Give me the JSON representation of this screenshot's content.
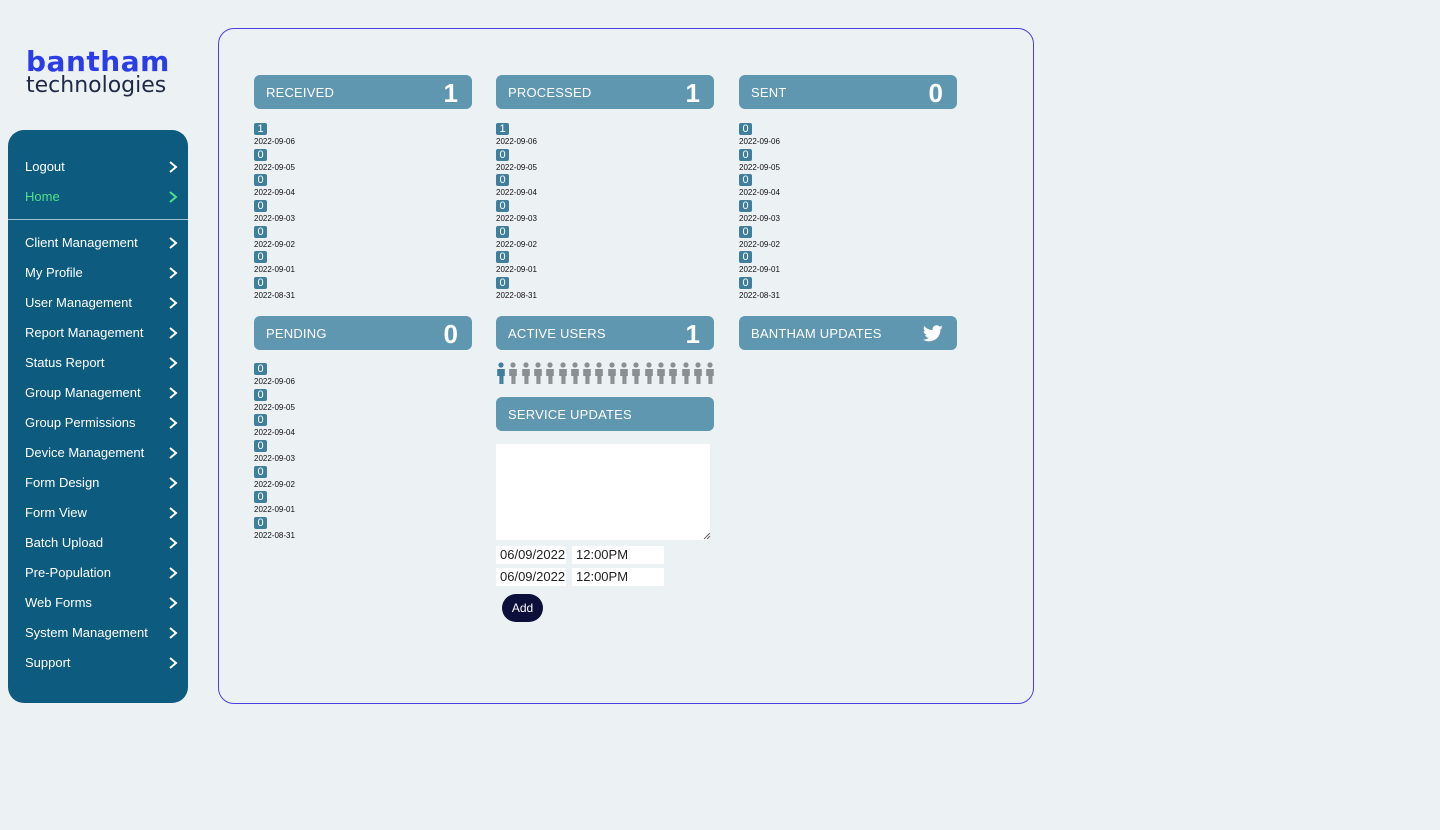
{
  "logo": {
    "line1": "bantham",
    "line2": "technologies"
  },
  "nav": {
    "top": [
      {
        "label": "Logout",
        "active": false
      },
      {
        "label": "Home",
        "active": true
      }
    ],
    "items": [
      "Client Management",
      "My Profile",
      "User  Management",
      "Report Management",
      "Status Report",
      "Group Management",
      "Group Permissions",
      "Device Management",
      "Form Design",
      "Form View",
      "Batch Upload",
      "Pre-Population",
      "Web Forms",
      "System Management",
      "Support"
    ]
  },
  "cards": {
    "received": {
      "title": "RECEIVED",
      "count": "1"
    },
    "processed": {
      "title": "PROCESSED",
      "count": "1"
    },
    "sent": {
      "title": "SENT",
      "count": "0"
    },
    "pending": {
      "title": "PENDING",
      "count": "0"
    },
    "active_users": {
      "title": "ACTIVE USERS",
      "count": "1"
    },
    "bantham_updates": {
      "title": "BANTHAM UPDATES",
      "icon": "twitter-icon"
    },
    "service_updates": {
      "title": "SERVICE UPDATES"
    }
  },
  "daily": {
    "received": [
      {
        "count": "1",
        "date": "2022-09-06"
      },
      {
        "count": "0",
        "date": "2022-09-05"
      },
      {
        "count": "0",
        "date": "2022-09-04"
      },
      {
        "count": "0",
        "date": "2022-09-03"
      },
      {
        "count": "0",
        "date": "2022-09-02"
      },
      {
        "count": "0",
        "date": "2022-09-01"
      },
      {
        "count": "0",
        "date": "2022-08-31"
      }
    ],
    "processed": [
      {
        "count": "1",
        "date": "2022-09-06"
      },
      {
        "count": "0",
        "date": "2022-09-05"
      },
      {
        "count": "0",
        "date": "2022-09-04"
      },
      {
        "count": "0",
        "date": "2022-09-03"
      },
      {
        "count": "0",
        "date": "2022-09-02"
      },
      {
        "count": "0",
        "date": "2022-09-01"
      },
      {
        "count": "0",
        "date": "2022-08-31"
      }
    ],
    "sent": [
      {
        "count": "0",
        "date": "2022-09-06"
      },
      {
        "count": "0",
        "date": "2022-09-05"
      },
      {
        "count": "0",
        "date": "2022-09-04"
      },
      {
        "count": "0",
        "date": "2022-09-03"
      },
      {
        "count": "0",
        "date": "2022-09-02"
      },
      {
        "count": "0",
        "date": "2022-09-01"
      },
      {
        "count": "0",
        "date": "2022-08-31"
      }
    ],
    "pending": [
      {
        "count": "0",
        "date": "2022-09-06"
      },
      {
        "count": "0",
        "date": "2022-09-05"
      },
      {
        "count": "0",
        "date": "2022-09-04"
      },
      {
        "count": "0",
        "date": "2022-09-03"
      },
      {
        "count": "0",
        "date": "2022-09-02"
      },
      {
        "count": "0",
        "date": "2022-09-01"
      },
      {
        "count": "0",
        "date": "2022-08-31"
      }
    ]
  },
  "active_users_icons": {
    "total": 18,
    "active": 1,
    "icon": "person-icon",
    "active_color": "#3f7f9c",
    "inactive_color": "#8a8f93"
  },
  "service_form": {
    "message": "",
    "start_date": "06/09/2022",
    "start_time": "12:00PM",
    "end_date": "06/09/2022",
    "end_time": "12:00PM",
    "add_label": "Add"
  },
  "colors": {
    "background": "#ecf1f4",
    "sidebar": "#0d5b7e",
    "card_header": "#5f96b0",
    "active_nav": "#4fe08a",
    "logo_blue": "#2b3de6",
    "button": "#0b0f3a",
    "border": "#4b3fe0"
  }
}
